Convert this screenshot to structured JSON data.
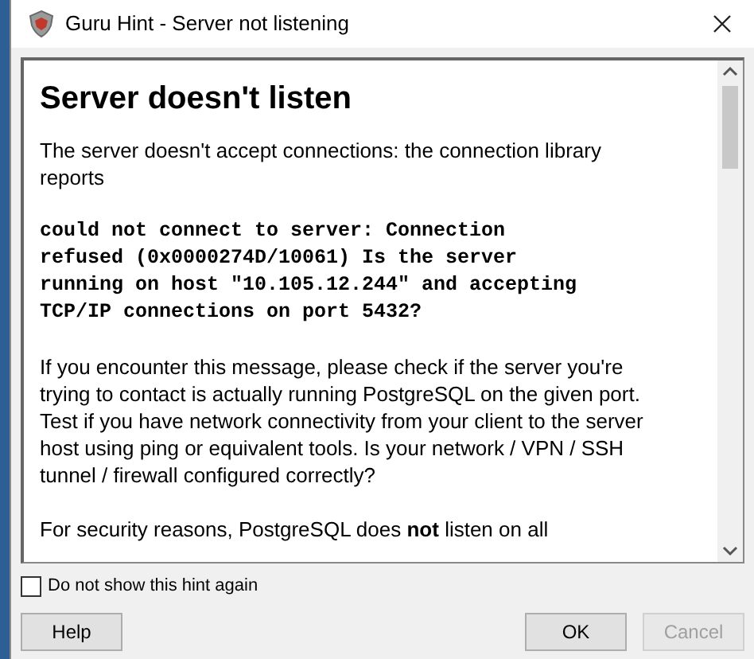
{
  "window": {
    "title": "Guru Hint - Server not listening"
  },
  "hint": {
    "heading": "Server doesn't listen",
    "paragraphs": [
      {
        "kind": "text",
        "text": "The server doesn't accept connections: the connection library reports"
      },
      {
        "kind": "code",
        "text": "could not connect to server: Connection refused (0x0000274D/10061) Is the server running on host \"10.105.12.244\" and accepting TCP/IP connections on port 5432?"
      },
      {
        "kind": "text",
        "text": "If you encounter this message, please check if the server you're trying to contact is actually running PostgreSQL on the given port. Test if you have network connectivity from your client to the server host using ping or equivalent tools. Is your network / VPN / SSH tunnel / firewall configured correctly?"
      },
      {
        "kind": "text",
        "text": "For security reasons, PostgreSQL does **not** listen on all"
      }
    ]
  },
  "dont_show_again": {
    "label": "Do not show this hint again",
    "checked": false
  },
  "buttons": [
    {
      "label": "Help",
      "disabled": false
    },
    {
      "label": "OK",
      "disabled": false
    },
    {
      "label": "Cancel",
      "disabled": true
    }
  ]
}
